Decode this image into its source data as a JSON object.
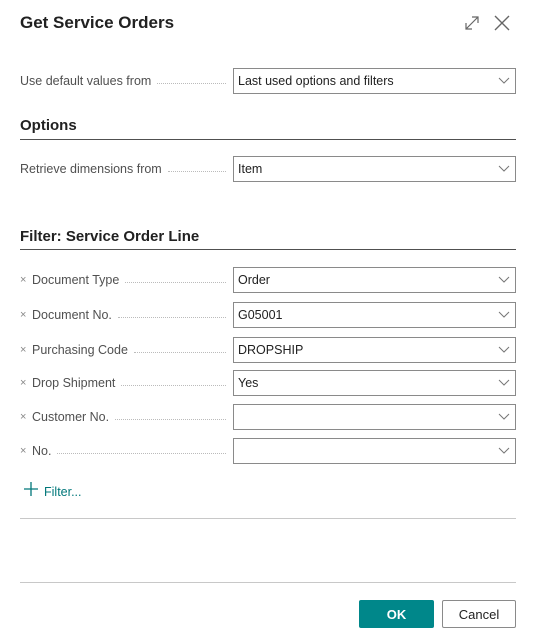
{
  "dialog": {
    "title": "Get Service Orders",
    "expand_icon": "expand-icon",
    "close_icon": "close-icon"
  },
  "defaults": {
    "label": "Use default values from",
    "value": "Last used options and filters"
  },
  "options": {
    "heading": "Options",
    "fields": [
      {
        "label": "Retrieve dimensions from",
        "value": "Item"
      }
    ]
  },
  "filter": {
    "heading": "Filter: Service Order Line",
    "remove_icon": "×",
    "fields": [
      {
        "label": "Document Type",
        "value": "Order"
      },
      {
        "label": "Document No.",
        "value": "G05001"
      },
      {
        "label": "Purchasing Code",
        "value": "DROPSHIP"
      },
      {
        "label": "Drop Shipment",
        "value": "Yes"
      },
      {
        "label": "Customer No.",
        "value": ""
      },
      {
        "label": "No.",
        "value": ""
      }
    ],
    "add_label": "Filter..."
  },
  "footer": {
    "ok_label": "OK",
    "cancel_label": "Cancel"
  },
  "colors": {
    "accent": "#00878a",
    "link": "#00777a"
  }
}
